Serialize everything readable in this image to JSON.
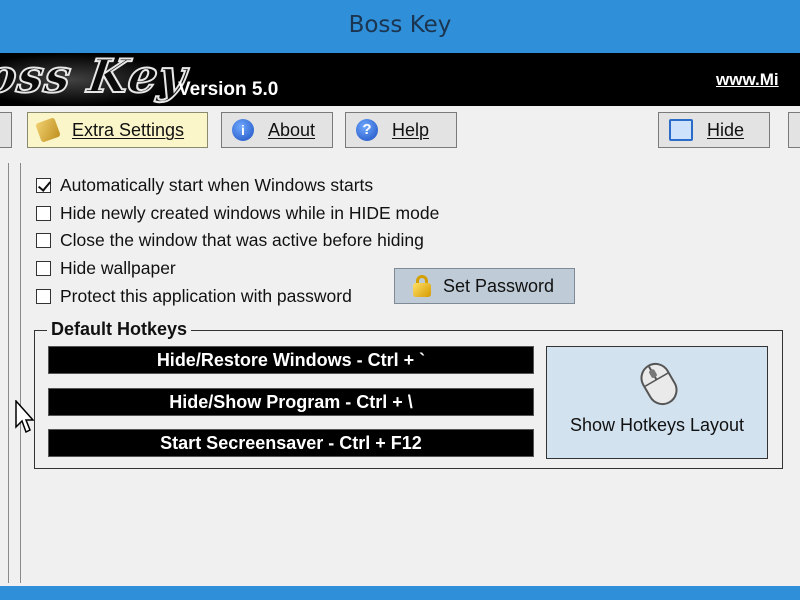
{
  "window": {
    "title": "Boss Key"
  },
  "banner": {
    "logo_text": "Boss Key",
    "version": "Version 5.0",
    "website": "www.Mi"
  },
  "toolbar": {
    "extra_settings": "Extra Settings",
    "about": "About",
    "help": "Help",
    "hide": "Hide"
  },
  "options": [
    {
      "label": "Automatically start when Windows starts",
      "checked": true
    },
    {
      "label": "Hide newly created windows while in HIDE mode",
      "checked": false
    },
    {
      "label": "Close the window that was active before hiding",
      "checked": false
    },
    {
      "label": "Hide wallpaper",
      "checked": false
    },
    {
      "label": "Protect this application with password",
      "checked": false
    }
  ],
  "set_password": "Set Password",
  "hotkeys": {
    "title": "Default Hotkeys",
    "items": [
      "Hide/Restore Windows - Ctrl + `",
      "Hide/Show Program - Ctrl + \\",
      "Start Secreensaver - Ctrl + F12"
    ],
    "show_layout": "Show Hotkeys Layout"
  },
  "colors": {
    "titlebar": "#2f8fd8",
    "active_tab": "#fbf6c9",
    "banner": "#000000"
  }
}
